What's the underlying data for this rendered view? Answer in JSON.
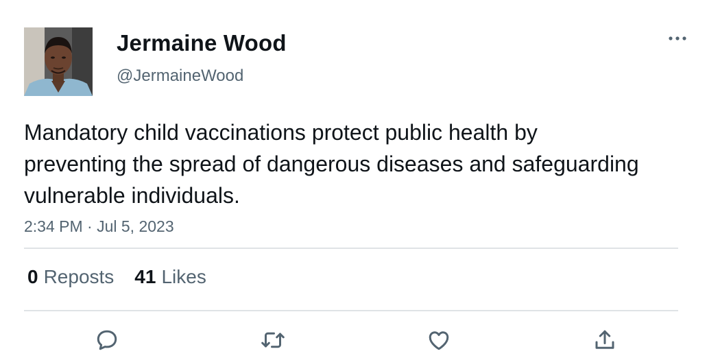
{
  "author": {
    "display_name": "Jermaine Wood",
    "handle": "@JermaineWood",
    "avatar_icon": "profile-photo"
  },
  "tweet": {
    "text": "Mandatory child vaccinations protect public health by preventing the spread of dangerous diseases and safeguarding vulnerable individuals.",
    "timestamp": "2:34 PM · Jul 5, 2023"
  },
  "stats": {
    "reposts_count": "0",
    "reposts_label": "Reposts",
    "likes_count": "41",
    "likes_label": "Likes"
  },
  "actions": {
    "reply_icon": "comment-icon",
    "repost_icon": "repost-icon",
    "like_icon": "heart-icon",
    "share_icon": "share-icon"
  },
  "menu": {
    "more_icon": "ellipsis-icon"
  },
  "colors": {
    "text_primary": "#0f1419",
    "text_secondary": "#536471",
    "divider": "#dfe3e6"
  }
}
